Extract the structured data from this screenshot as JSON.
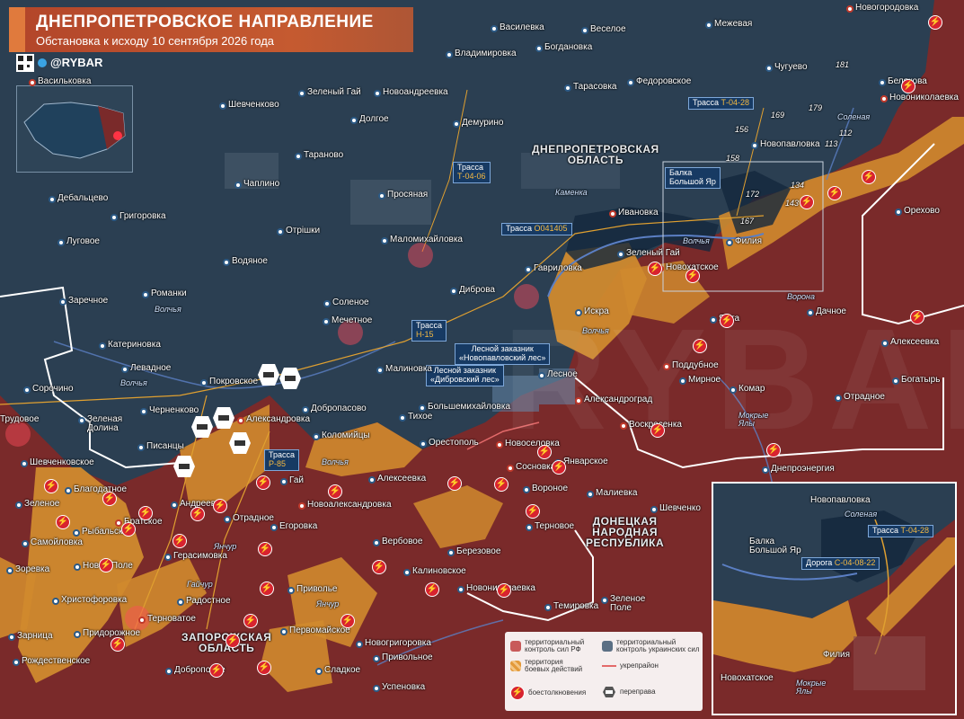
{
  "header": {
    "title": "ДНЕПРОПЕТРОВСКОЕ НАПРАВЛЕНИЕ",
    "subtitle": "Обстановка к исходу 10 сентября 2026 года",
    "handle": "@RYBAR"
  },
  "colors": {
    "russian_control": "#7a2a2a",
    "combat_zone": "#d08a2e",
    "ukrainian_control": "#2b3f52",
    "header": "#c1502f",
    "fortification": "#e36a6a"
  },
  "regions": {
    "dnipro": "ДНЕПРОПЕТРОВСКАЯ\nОБЛАСТЬ",
    "donetsk": "ДОНЕЦКАЯ\nНАРОДНАЯ\nРЕСПУБЛИКА",
    "zaporozhye": "ЗАПОРОЖСКАЯ\nОБЛАСТЬ"
  },
  "roads": {
    "t0428": {
      "prefix": "Трасса ",
      "code": "Т-04-28"
    },
    "t0406": {
      "prefix": "Трасса",
      "code": "Т-04-06"
    },
    "o041405": {
      "prefix": "Трасса ",
      "code": "О041405"
    },
    "h15": {
      "prefix": "Трасса",
      "code": "Н-15"
    },
    "p85": {
      "prefix": "Трасса",
      "code": "Р-85"
    },
    "inset_t0428": {
      "prefix": "Трасса ",
      "code": "Т-04-28"
    },
    "inset_c040822": {
      "prefix": "Дорога ",
      "code": "С-04-08-22"
    }
  },
  "reserves": {
    "novopavlovsky": "Лесной заказник\n«Новопавловский лес»",
    "dibrovsky": "Лесной заказник\n«Дибровский лес»"
  },
  "balka": "Балка\nБольшой Яр",
  "rivers": {
    "volchya1": "Волчья",
    "volchya2": "Волчья",
    "volchya3": "Волчья",
    "volchya4": "Волчья",
    "volchya5": "Волчья",
    "kamenka": "Каменка",
    "solenaya": "Соленая",
    "vorona": "Ворона",
    "mokrye_yaly": "Мокрые\nЯлы",
    "yanchur1": "Янчур",
    "yanchur2": "Янчур",
    "gaichur": "Гайчур",
    "inset_solenaya": "Соленая",
    "inset_mokrye_yaly": "Мокрые\nЯлы"
  },
  "heights": [
    "181",
    "179",
    "169",
    "156",
    "112",
    "113",
    "158",
    "134",
    "172",
    "143",
    "167"
  ],
  "towns": {
    "novogrodovka": "Новогородовка",
    "vasilevka": "Василевка",
    "veseloe": "Веселое",
    "mezhevaya": "Межевая",
    "bogdanovka": "Богдановка",
    "vladimirovka": "Владимировка",
    "chuguevo": "Чугуево",
    "belyakovka": "Белякова",
    "novonikolaevka": "Новониколаевка",
    "vasilkovka": "Васильковка",
    "shevchenkovo": "Шевченково",
    "zeleny_gai": "Зеленый Гай",
    "novoandreevka": "Новоандреевка",
    "tarasovka": "Тарасовка",
    "fedorovskoe": "Федоровское",
    "dolgoe": "Долгое",
    "demurino": "Демурино",
    "novopavlovka": "Новопавловка",
    "taranovo": "Тараново",
    "debaltsevo": "Дебальцево",
    "chaplino": "Чаплино",
    "prosyanaya": "Просяная",
    "grigorovka": "Григоровка",
    "otrishki": "Отрішки",
    "ivanovka": "Ивановка",
    "orekhovo": "Орехово",
    "lugovoe": "Луговое",
    "maloмikhailovka": "Маломихайловка",
    "vodyanoe": "Водяное",
    "gavrilovka": "Гавриловка",
    "filiya": "Филия",
    "zeleny_gai2": "Зеленый Гай",
    "novokhatskoe": "Новохатское",
    "romanki": "Романки",
    "dibrova": "Диброва",
    "zarechnoe": "Заречное",
    "solenoe": "Соленое",
    "iskra": "Искра",
    "yalta": "Ялта",
    "dachnoe": "Дачное",
    "mechetnoe": "Мечетное",
    "katerinovka": "Катериновка",
    "alekseevka": "Алексеевка",
    "levadnoe": "Левадное",
    "malinovka": "Малиновка",
    "poddubnoe": "Поддубное",
    "mirnoe": "Мирное",
    "bogatyr": "Богатырь",
    "sorochino": "Сорочино",
    "pokrovskoe": "Покровское",
    "lesnoe": "Лесное",
    "aleksandrograd": "Александроград",
    "komar": "Комар",
    "otradnoe": "Отрадное",
    "chernenkovo": "Черненково",
    "dobropasovo": "Добропасово",
    "bolshemikhailovka": "Большемихайловка",
    "trudovoe": "Трудовое",
    "zelenaya_dolina": "Зеленая\nДолина",
    "aleksandrovka": "Александровка",
    "tikhoe": "Тихое",
    "voskresenka": "Воскресенка",
    "kolomiytsy": "Коломийцы",
    "pisantsy": "Писанцы",
    "orestopol": "Орестополь",
    "novoselovka": "Новоселовка",
    "shevchenkovskoe": "Шевченковское",
    "sosnovka": "Сосновка",
    "yanvarskoe": "Январское",
    "dneproenergiya": "Днепроэнергия",
    "blagodatnoe": "Благодатное",
    "gai": "Гай",
    "alekseevka2": "Алексеевка",
    "voronoe": "Вороное",
    "malievka": "Малиевка",
    "zelenoe": "Зеленое",
    "andreevka": "Андреевка",
    "novoaleksandrovka": "Новоалександровка",
    "shevchenko": "Шевченко",
    "bratskoe": "Братское",
    "otradnoe2": "Отрадное",
    "ternovoe": "Терновое",
    "rybalskoe": "Рыбальское",
    "egorovka": "Егоровка",
    "verbovoe": "Вербовое",
    "berezovoe": "Березовое",
    "samoylovka": "Самойловка",
    "gerasimovka": "Герасимовка",
    "kalinovskoe": "Калиновское",
    "novoe_pole": "Новое Поле",
    "privolnoe": "Приволье",
    "novonikolaevka2": "Новониколаевка",
    "zorevka": "Зоревка",
    "khristoforovka": "Христофоровка",
    "radostnoe": "Радостное",
    "zelenoe_pole": "Зеленое\nПоле",
    "temirovka": "Темировка",
    "ternovatoe": "Терноватое",
    "pervomayskoe": "Первомайское",
    "pridorozhnoe": "Придорожное",
    "zarnitsa": "Зарница",
    "novogrigorovka": "Новогригоровка",
    "privolnoe2": "Привольное",
    "rozhdestvenskoe": "Рождественское",
    "sladkoe": "Сладкое",
    "dobropolye": "Доброполье",
    "uspenovka": "Успеновка"
  },
  "inset": {
    "novopavlovka": "Новопавловка",
    "filiya": "Филия",
    "novokhatskoe": "Новохатское",
    "balka": "Балка\nБольшой Яр"
  },
  "legend": {
    "rf_control": "территориальный\nконтроль сил РФ",
    "ua_control": "территориальный\nконтроль украинских сил",
    "combat": "территория\nбоевых действий",
    "fort": "укрепрайон",
    "clash": "боестолкновения",
    "crossing": "переправа"
  },
  "watermark": "RYBAR",
  "combat_glyph": "⚡"
}
